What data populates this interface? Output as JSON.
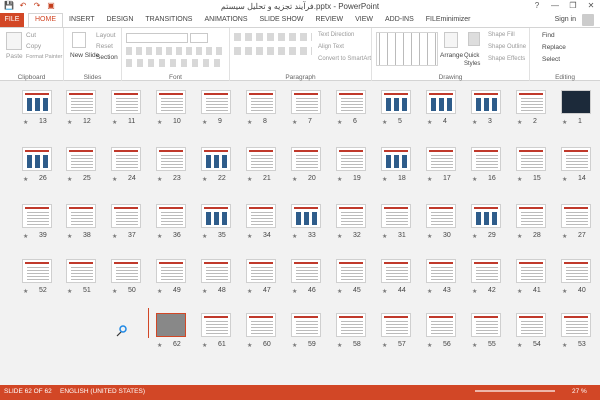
{
  "window": {
    "title": "فرآیند تجزیه و تحلیل سیستم.pptx - PowerPoint",
    "controls": [
      "?",
      "—",
      "❐",
      "✕"
    ]
  },
  "qat": {
    "save": "💾",
    "undo": "↶",
    "redo": "↷",
    "present": "▣"
  },
  "tabs": {
    "file": "FILE",
    "items": [
      "HOME",
      "INSERT",
      "DESIGN",
      "TRANSITIONS",
      "ANIMATIONS",
      "SLIDE SHOW",
      "REVIEW",
      "VIEW",
      "ADD-INS",
      "FILEminimizer"
    ],
    "active": "HOME",
    "signin": "Sign in"
  },
  "ribbon": {
    "clipboard": {
      "label": "Clipboard",
      "paste": "Paste",
      "cut": "Cut",
      "copy": "Copy",
      "format_painter": "Format Painter"
    },
    "slides": {
      "label": "Slides",
      "new_slide": "New Slide",
      "layout": "Layout",
      "reset": "Reset",
      "section": "Section"
    },
    "font": {
      "label": "Font"
    },
    "paragraph": {
      "label": "Paragraph",
      "text_direction": "Text Direction",
      "align_text": "Align Text",
      "convert": "Convert to SmartArt"
    },
    "drawing": {
      "label": "Drawing",
      "arrange": "Arrange",
      "quick_styles": "Quick Styles",
      "shape_fill": "Shape Fill",
      "shape_outline": "Shape Outline",
      "shape_effects": "Shape Effects"
    },
    "editing": {
      "label": "Editing",
      "find": "Find",
      "replace": "Replace",
      "select": "Select"
    }
  },
  "slides": {
    "rows": [
      [
        "1",
        "2",
        "3",
        "4",
        "5",
        "6",
        "7",
        "8",
        "9",
        "10",
        "11",
        "12",
        "13"
      ],
      [
        "14",
        "15",
        "16",
        "17",
        "18",
        "19",
        "20",
        "21",
        "22",
        "23",
        "24",
        "25",
        "26"
      ],
      [
        "27",
        "28",
        "29",
        "30",
        "31",
        "32",
        "33",
        "34",
        "35",
        "36",
        "37",
        "38",
        "39"
      ],
      [
        "40",
        "41",
        "42",
        "43",
        "44",
        "45",
        "46",
        "47",
        "48",
        "49",
        "50",
        "51",
        "52"
      ],
      [
        "53",
        "54",
        "55",
        "56",
        "57",
        "58",
        "59",
        "60",
        "61",
        "62"
      ]
    ],
    "selected": "62"
  },
  "status": {
    "slide": "SLIDE 62 OF 62",
    "language": "ENGLISH (UNITED STATES)",
    "zoom": "27 %"
  },
  "colors": {
    "accent": "#d24726",
    "status": "#d24726"
  }
}
